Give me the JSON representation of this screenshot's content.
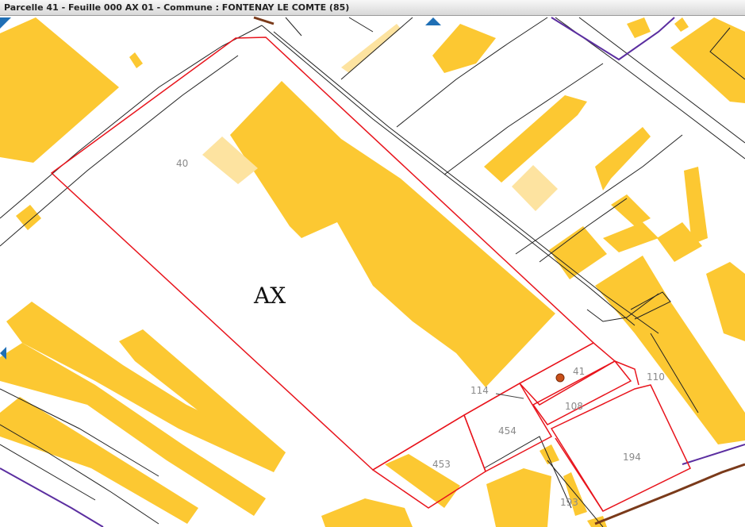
{
  "window": {
    "title": "Parcelle 41 - Feuille 000 AX 01 - Commune : FONTENAY LE COMTE (85)"
  },
  "map": {
    "section_label": "AX",
    "parcel_labels": {
      "p40": "40",
      "p41": "41",
      "p114": "114",
      "p110": "110",
      "p108": "108",
      "p454": "454",
      "p453": "453",
      "p194": "194",
      "p193": "193"
    },
    "colors": {
      "building": "#fcc832",
      "building_light": "#fde3a0",
      "parcel_line": "#222222",
      "selected_parcel": "#e8141c",
      "commune_boundary": "#5b2ea0",
      "road_brown": "#7a3a1a",
      "marker": "#c8501a",
      "nav_arrow": "#1f6fb5"
    }
  }
}
